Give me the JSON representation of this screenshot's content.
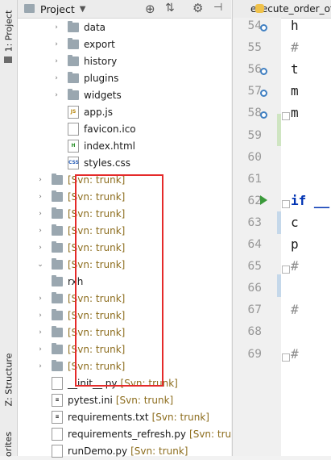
{
  "sidebar": {
    "tabs": [
      {
        "label": "1: Project"
      },
      {
        "label": "Z: Structure"
      },
      {
        "label": "orites"
      }
    ]
  },
  "project_panel": {
    "title": "Project",
    "tree": [
      {
        "label": "data",
        "kind": "folder",
        "arrow": "›"
      },
      {
        "label": "export",
        "kind": "folder",
        "arrow": "›"
      },
      {
        "label": "history",
        "kind": "folder",
        "arrow": "›"
      },
      {
        "label": "plugins",
        "kind": "folder",
        "arrow": "›"
      },
      {
        "label": "widgets",
        "kind": "folder",
        "arrow": "›"
      },
      {
        "label": "app.js",
        "kind": "file",
        "badge": "JS"
      },
      {
        "label": "favicon.ico",
        "kind": "file",
        "badge": ""
      },
      {
        "label": "index.html",
        "kind": "file",
        "badge": "H"
      },
      {
        "label": "styles.css",
        "kind": "file",
        "badge": "CSS"
      },
      {
        "label": "[Svn: trunk]",
        "kind": "folder",
        "arrow": "›",
        "svn": true
      },
      {
        "label": "[Svn: trunk]",
        "kind": "folder",
        "arrow": "›",
        "svn": true
      },
      {
        "label": "[Svn: trunk]",
        "kind": "folder",
        "arrow": "›",
        "svn": true
      },
      {
        "label": "[Svn: trunk]",
        "kind": "folder",
        "arrow": "›",
        "svn": true
      },
      {
        "label": "[Svn: trunk]",
        "kind": "folder",
        "arrow": "›",
        "svn": true
      },
      {
        "label": "[Svn: trunk]",
        "kind": "folder",
        "arrow": "⌄",
        "svn": true
      },
      {
        "label": "rxh",
        "kind": "folder"
      },
      {
        "label": "[Svn: trunk]",
        "kind": "folder",
        "arrow": "›",
        "svn": true
      },
      {
        "label": "[Svn: trunk]",
        "kind": "folder",
        "arrow": "›",
        "svn": true
      },
      {
        "label": "[Svn: trunk]",
        "kind": "folder",
        "arrow": "›",
        "svn": true
      },
      {
        "label": "[Svn: trunk]",
        "kind": "folder",
        "arrow": "›",
        "svn": true
      },
      {
        "label": "[Svn: trunk]",
        "kind": "folder",
        "arrow": "›",
        "svn": true
      },
      {
        "label": "__init__.py",
        "kind": "file",
        "badge": "",
        "suffix": "[Svn: trunk]"
      },
      {
        "label": "pytest.ini",
        "kind": "file",
        "badge": "≡",
        "suffix": "[Svn: trunk]"
      },
      {
        "label": "requirements.txt",
        "kind": "file",
        "badge": "≡",
        "suffix": "[Svn: trunk]"
      },
      {
        "label": "requirements_refresh.py",
        "kind": "file",
        "badge": "",
        "suffix": "[Svn: trunk]"
      },
      {
        "label": "runDemo.py",
        "kind": "file",
        "badge": "",
        "suffix": "[Svn: trunk]"
      }
    ]
  },
  "editor": {
    "tab_label": "execute_order_of",
    "lines": [
      {
        "num": "54",
        "code": "h"
      },
      {
        "num": "55",
        "code": "#"
      },
      {
        "num": "56",
        "code": "t"
      },
      {
        "num": "57",
        "code": "m"
      },
      {
        "num": "58",
        "code": "m"
      },
      {
        "num": "59",
        "code": ""
      },
      {
        "num": "60",
        "code": ""
      },
      {
        "num": "61",
        "code": ""
      },
      {
        "num": "62",
        "code": "if __"
      },
      {
        "num": "63",
        "code": "c"
      },
      {
        "num": "64",
        "code": "p"
      },
      {
        "num": "65",
        "code": "#"
      },
      {
        "num": "66",
        "code": ""
      },
      {
        "num": "67",
        "code": "#"
      },
      {
        "num": "68",
        "code": ""
      },
      {
        "num": "69",
        "code": "#"
      }
    ]
  }
}
